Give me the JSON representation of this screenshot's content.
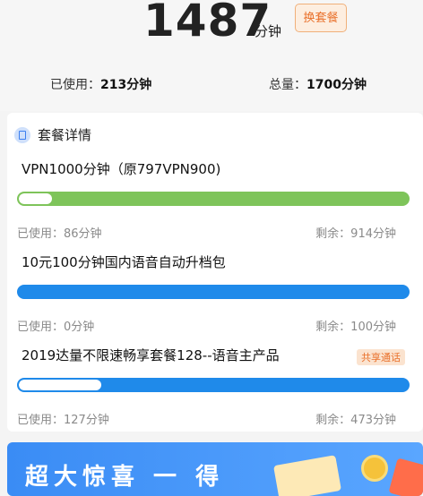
{
  "summary": {
    "remaining": "1487",
    "unit": "分钟",
    "change_label": "换套餐",
    "used_label": "已使用：",
    "used_value": "213分钟",
    "total_label": "总量：",
    "total_value": "1700分钟"
  },
  "details": {
    "title": "套餐详情",
    "packages": [
      {
        "name": "VPN1000分钟（原797VPN900)",
        "used": "已使用：86分钟",
        "remaining": "剩余：914分钟",
        "remaining_fraction": 0.914,
        "color": "#7ec45a"
      },
      {
        "name": "10元100分钟国内语音自动升档包",
        "used": "已使用：0分钟",
        "remaining": "剩余：100分钟",
        "remaining_fraction": 1.0,
        "color": "#1f8aea"
      },
      {
        "name": "2019达量不限速畅享套餐128--语音主产品",
        "badge": "共享通话",
        "used": "已使用：127分钟",
        "remaining": "剩余：473分钟",
        "remaining_fraction": 0.788,
        "color": "#1f8aea"
      }
    ]
  },
  "banner": {
    "text": "超大惊喜 一 得"
  }
}
